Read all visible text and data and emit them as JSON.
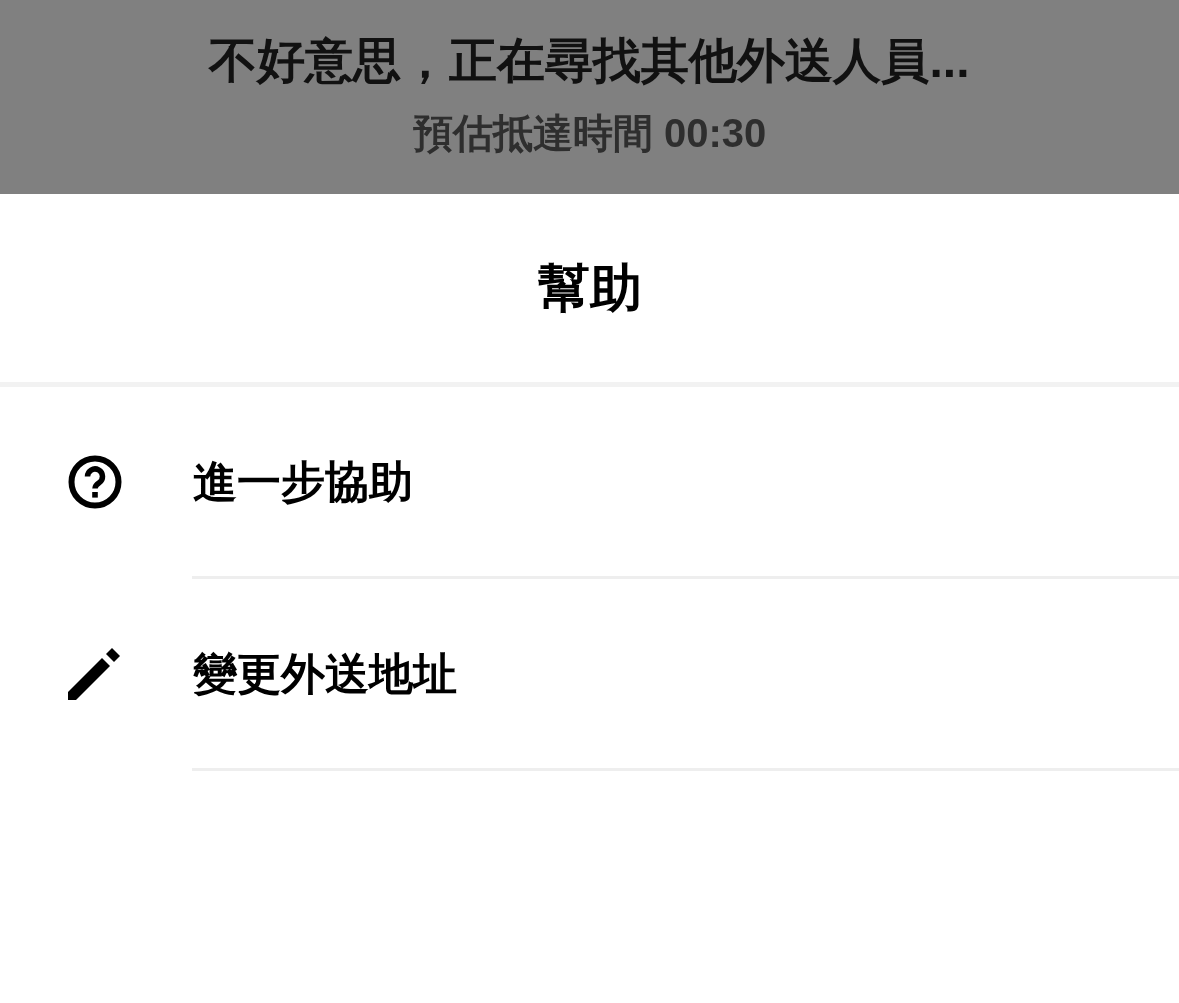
{
  "status_banner": {
    "title": "不好意思，正在尋找其他外送人員...",
    "subtitle": "預估抵達時間 00:30"
  },
  "sheet": {
    "title": "幫助"
  },
  "menu_items": [
    {
      "kind": "help",
      "label": "進一步協助"
    },
    {
      "kind": "edit",
      "label": "變更外送地址"
    }
  ]
}
